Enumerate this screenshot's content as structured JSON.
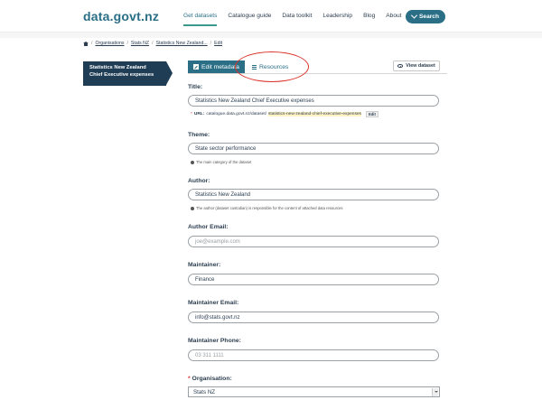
{
  "header": {
    "logo": "data.govt.nz",
    "nav": [
      "Get datasets",
      "Catalogue guide",
      "Data toolkit",
      "Leadership",
      "Blog",
      "About"
    ],
    "search_label": "Search"
  },
  "breadcrumb": {
    "items": [
      "Organisations",
      "Stats NZ",
      "Statistics New Zealand...",
      "Edit"
    ]
  },
  "sidebar": {
    "dataset_title": "Statistics New Zealand Chief Executive expenses"
  },
  "tabs": {
    "edit_label": "Edit metadata",
    "resources_label": "Resources",
    "view_dataset_label": "View dataset"
  },
  "form": {
    "title_label": "Title:",
    "title_value": "Statistics New Zealand Chief Executive expenses",
    "url_label": "URL:",
    "url_base": "catalogue.data.govt.nz/dataset/",
    "url_slug": "statistics-new-zealand-chief-executive-expenses",
    "url_edit": "Edit",
    "theme_label": "Theme:",
    "theme_value": "State sector performance",
    "theme_hint": "The main category of the dataset",
    "author_label": "Author:",
    "author_value": "Statistics New Zealand",
    "author_hint": "The author (dataset custodian) is responsible for the content of attached data resources",
    "author_email_label": "Author Email:",
    "author_email_placeholder": "joe@example.com",
    "maintainer_label": "Maintainer:",
    "maintainer_value": "Finance",
    "maintainer_email_label": "Maintainer Email:",
    "maintainer_email_value": "info@stats.govt.nz",
    "maintainer_phone_label": "Maintainer Phone:",
    "maintainer_phone_placeholder": "03 311 1111",
    "organisation_label": "Organisation:",
    "organisation_value": "Stats NZ"
  },
  "colors": {
    "brand": "#2a6f86",
    "sidebar_bg": "#1f3d55",
    "highlight_circle": "#d9342b"
  }
}
